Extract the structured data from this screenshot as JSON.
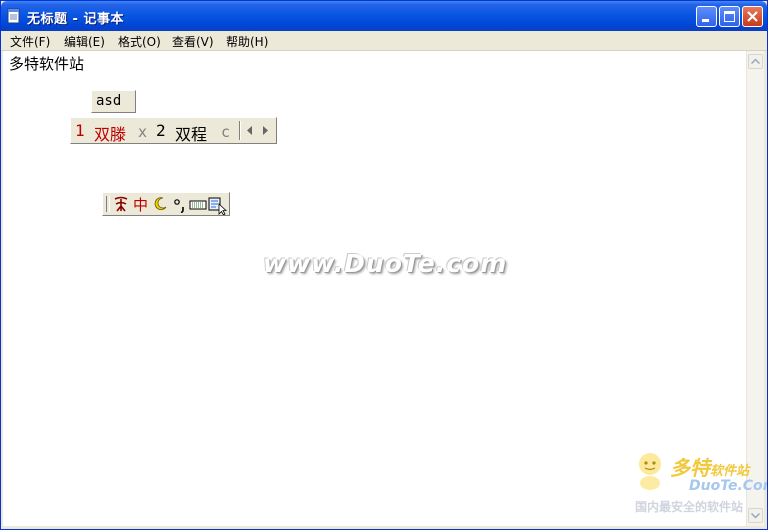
{
  "window": {
    "title": "无标题 - 记事本"
  },
  "menu": [
    {
      "label": "文件(F)"
    },
    {
      "label": "编辑(E)"
    },
    {
      "label": "格式(O)"
    },
    {
      "label": "查看(V)"
    },
    {
      "label": "帮助(H)"
    }
  ],
  "editor": {
    "text": "多特软件站"
  },
  "ime": {
    "composition": "asd",
    "candidates": [
      {
        "num": "1",
        "text": "双滕",
        "key": "x"
      },
      {
        "num": "2",
        "text": "双程",
        "key": "c"
      }
    ],
    "mode_label": "中"
  },
  "watermark": {
    "text": "www.DuoTe.com"
  },
  "corner_logo": {
    "cn": "多特",
    "cn_small": "软件站",
    "en": "DuoTe.Com",
    "tagline": "国内最安全的软件站"
  },
  "colors": {
    "titlebar": "#0a57e4",
    "candidate_highlight": "#c00000"
  }
}
